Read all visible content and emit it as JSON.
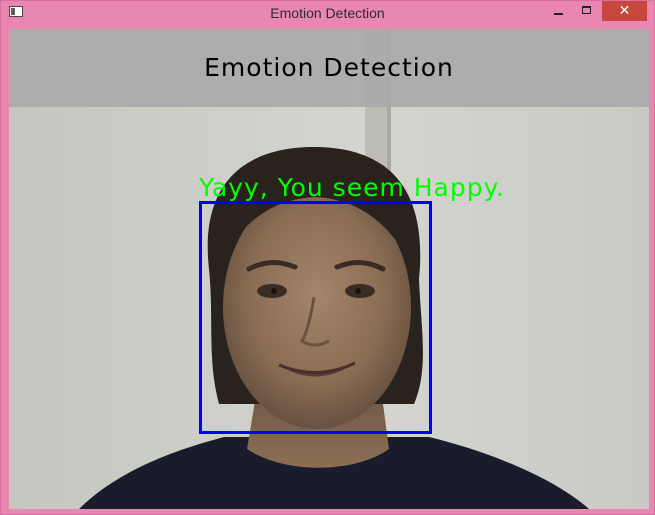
{
  "window": {
    "title": "Emotion Detection",
    "close_glyph": "✕",
    "title_bar_color": "#ea86b2",
    "close_button_color": "#c7463d"
  },
  "video": {
    "banner_title": "Emotion Detection",
    "emotion_message": "Yayy, You seem Happy.",
    "detected_emotion": "Happy",
    "label_color": "#00ff00",
    "face_box_color": "#0000ff"
  },
  "icons": {
    "app": "app-window-icon",
    "minimize": "minimize-icon",
    "maximize": "maximize-icon",
    "close": "close-icon"
  }
}
